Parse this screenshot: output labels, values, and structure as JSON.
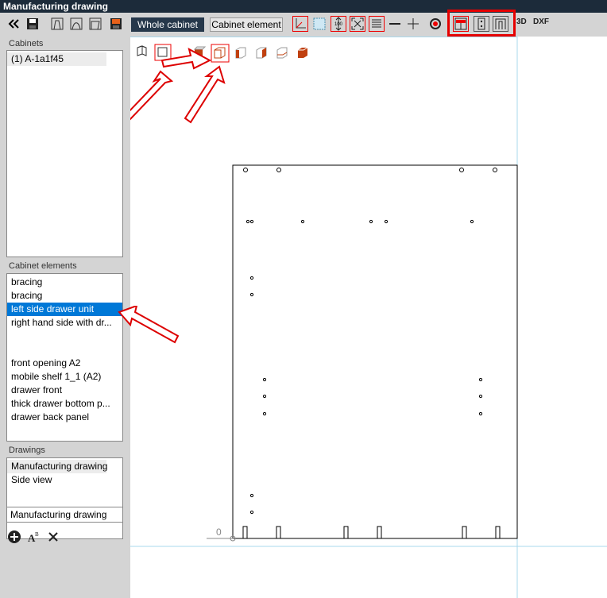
{
  "window": {
    "title": "Manufacturing drawing"
  },
  "tabs": {
    "whole_cabinet": "Whole cabinet",
    "cabinet_element": "Cabinet element"
  },
  "toolbar": {
    "icons": [
      "collapse-icon",
      "save-icon",
      "profile-a-icon",
      "profile-b-icon",
      "profile-c-icon",
      "save-color-icon",
      "corner-icon",
      "grid-icon",
      "dimension-100-icon",
      "fit-icon",
      "hatch-icon",
      "line-icon",
      "cross-icon",
      "target-icon",
      "drawer-front-view-icon",
      "drawer-side-view-icon",
      "drawer-unit-view-icon"
    ],
    "dimension_label": "100",
    "label_3d": "3D",
    "label_dxf": "DXF"
  },
  "view_icons": [
    "iso-view-icon",
    "front-view-icon",
    "view-top-icon",
    "view-cube-icon",
    "view-left-icon",
    "view-right-icon",
    "view-back-icon",
    "view-bottom-icon"
  ],
  "sidebar": {
    "cabinets_label": "Cabinets",
    "cabinets": [
      "(1) A-1a1f45"
    ],
    "elements_label": "Cabinet elements",
    "elements": [
      "bracing",
      "bracing",
      "left side drawer unit",
      "right hand side with dr...",
      "",
      "",
      "front opening A2",
      "mobile shelf 1_1 (A2)",
      "drawer front",
      "thick drawer bottom p...",
      "drawer back panel"
    ],
    "selected_element": 2,
    "drawings_label": "Drawings",
    "drawings": [
      "Manufacturing drawing",
      "Side view"
    ],
    "drawing_name_value": "Manufacturing drawing",
    "bottom_icons": [
      "add-icon",
      "rename-icon",
      "delete-icon"
    ]
  },
  "drawing": {
    "origin_label": "0"
  },
  "colors": {
    "title_bg": "#1c2b3a",
    "tab_active": "#26384b",
    "selection": "#0078d7",
    "highlight": "#e60000"
  }
}
